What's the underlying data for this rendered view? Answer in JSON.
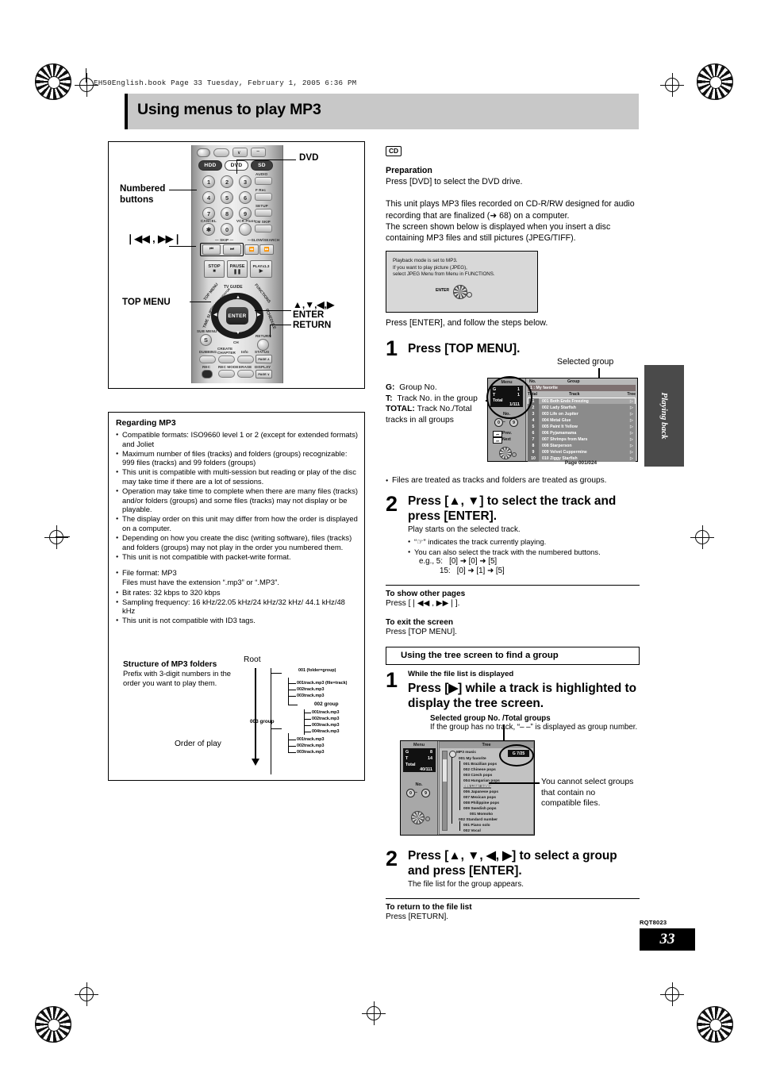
{
  "file_header": "EH50English.book  Page 33  Tuesday, February 1, 2005  6:36 PM",
  "title": "Using menus to play MP3",
  "side_tab": "Playing back",
  "footer": {
    "code": "RQT8023",
    "page": "33"
  },
  "remote": {
    "callouts": {
      "dvd": "DVD",
      "numbered_buttons": "Numbered\nbuttons",
      "skip": "❘◀◀ , ▶▶❘",
      "top_menu": "TOP MENU",
      "cursor": "▲,▼,◀,▶",
      "enter": "ENTER",
      "return": "RETURN"
    },
    "source_buttons": [
      "HDD",
      "DVD",
      "SD"
    ],
    "number_keys": [
      "1",
      "2",
      "3",
      "4",
      "5",
      "6",
      "7",
      "8",
      "9",
      "0"
    ],
    "side_labels": [
      "AUDIO",
      "F Rec",
      "SETUP",
      "CM SKIP"
    ],
    "cancel_label": "CANCEL",
    "vcrplus_label": "VCR Plus+",
    "skip_label": "SKIP",
    "slow_search_label": "SLOW/SEARCH",
    "transport": [
      "STOP",
      "PAUSE",
      "PLAYx1.3"
    ],
    "dial_labels": [
      "TOP MENU",
      "DIRECT NAVIGATOR",
      "TV GUIDE",
      "FUNCTIONS",
      "TIME SLIP",
      "SCHEDULE",
      "CH"
    ],
    "enter_label": "ENTER",
    "return_label": "RETURN",
    "sub_menu_label": "SUB MENU",
    "bottom_buttons": [
      "DUBBING",
      "CREATE CHAPTER",
      "Info",
      "STATUS",
      "REC",
      "REC MODE",
      "ERASE",
      "DISPLAY"
    ],
    "page_up": "PAGE ∧",
    "page_down": "PAGE ∨"
  },
  "regarding_mp3": {
    "heading": "Regarding MP3",
    "bullets": [
      "Compatible formats: ISO9660 level 1 or 2 (except for extended formats) and Joliet",
      "Maximum number of files (tracks) and folders (groups) recognizable: 999 files (tracks) and 99 folders (groups)",
      "This unit is compatible with multi-session but reading or play of the disc may take time if there are a lot of sessions.",
      "Operation may take time to complete when there are many files (tracks) and/or folders (groups) and some files (tracks) may not display or be playable.",
      "The display order on this unit may differ from how the order is displayed on a computer.",
      "Depending on how you create the disc (writing software), files (tracks) and folders (groups) may not play in the order you numbered them.",
      "This unit is not compatible with packet-write format."
    ],
    "bullets2": [
      "File format: MP3",
      "Bit rates: 32 kbps to 320 kbps",
      "Sampling frequency: 16 kHz/22.05 kHz/24 kHz/32 kHz/ 44.1 kHz/48 kHz",
      "This unit is not compatible with ID3 tags."
    ],
    "file_format_sub": "Files must have the extension “.mp3” or “.MP3”.",
    "structure": {
      "heading": "Structure of MP3 folders",
      "text": "Prefix with 3-digit numbers in the order you want to play them.",
      "root_label": "Root",
      "order_label": "Order of play",
      "group1": "001 (folder=group)",
      "group1_files": [
        "001track.mp3 (file=track)",
        "002track.mp3",
        "003track.mp3"
      ],
      "group2": "002 group",
      "group2_files": [
        "001track.mp3",
        "002track.mp3",
        "003track.mp3",
        "004track.mp3"
      ],
      "group3": "003 group",
      "group3_files": [
        "001track.mp3",
        "002track.mp3",
        "003track.mp3"
      ]
    }
  },
  "right": {
    "cd_tag": "CD",
    "preparation_heading": "Preparation",
    "preparation_text": "Press [DVD] to select the DVD drive.",
    "intro": "This unit plays MP3 files recorded on CD-R/RW designed for audio recording that are finalized (➜ 68) on a computer.\nThe screen shown below is displayed when you insert a disc containing MP3 files and still pictures (JPEG/TIFF).",
    "osd_note": "Playback mode is set to MP3.\nIf you want to play picture (JPEG),\nselect JPEG Menu from Menu in FUNCTIONS.",
    "osd_note_enter": "ENTER",
    "after_note": "Press [ENTER], and follow the steps below.",
    "step1": {
      "num": "1",
      "title": "Press [TOP MENU]."
    },
    "selected_group_label": "Selected group",
    "legend": {
      "g": "G:",
      "g_text": "Group No.",
      "t": "T:",
      "t_text": "Track No. in the group",
      "total": "TOTAL:",
      "total_text": "Track No./Total tracks in all groups"
    },
    "files_note": "Files are treated as tracks and folders are treated as groups.",
    "step2": {
      "num": "2",
      "title": "Press [▲, ▼] to select the track and press [ENTER].",
      "line1": "Play starts on the selected track.",
      "bullets": [
        "“☞” indicates the track currently playing.",
        "You can also select the track with the numbered buttons."
      ],
      "eg_label": "e.g., 5:",
      "eg1": "[0] ➜ [0] ➜ [5]",
      "eg2_label": "15:",
      "eg2": "[0] ➜ [1] ➜ [5]"
    },
    "other_pages_h": "To show other pages",
    "other_pages_p": "Press [❘◀◀ , ▶▶❘].",
    "exit_h": "To exit the screen",
    "exit_p": "Press [TOP MENU].",
    "tree_section": "Using the tree screen to find a group",
    "tstep1": {
      "num": "1",
      "cond": "While the file list is displayed",
      "title": "Press [▶] while a track is highlighted to display the tree screen.",
      "callout_h": "Selected group No. /Total groups",
      "callout_p": "If the group has no track, “– –” is displayed as group number."
    },
    "tree_note": "You cannot select groups that contain no compatible files.",
    "tstep2": {
      "num": "2",
      "title": "Press [▲, ▼, ◀, ▶] to select a group and press [ENTER].",
      "line1": "The file list for the group appears."
    },
    "return_h": "To return to the file list",
    "return_p": "Press [RETURN]."
  },
  "file_list_screen": {
    "menu_label": "Menu",
    "g_label": "G",
    "g_value": "1",
    "t_label": "T",
    "t_value": "1",
    "total_label": "Total",
    "total_value": "1/111",
    "no_label": "No.",
    "num_range": [
      "0",
      "–",
      "9"
    ],
    "prev": "Prev.",
    "next": "Next",
    "col_no": "No.",
    "col_group": "Group",
    "col_total": "Total",
    "col_track": "Track",
    "col_tree": "Tree",
    "group_row": "1  :  My favorite",
    "tracks": [
      {
        "no": "1",
        "name": "001 Both Ends Freezing"
      },
      {
        "no": "2",
        "name": "002 Lady Starfish"
      },
      {
        "no": "3",
        "name": "003 Life on Jupiter"
      },
      {
        "no": "4",
        "name": "004 Metal Glue"
      },
      {
        "no": "5",
        "name": "005 Paint It Yellow"
      },
      {
        "no": "6",
        "name": "006 Pyjamamama"
      },
      {
        "no": "7",
        "name": "007 Shrimps from Mars"
      },
      {
        "no": "8",
        "name": "008 Starperson"
      },
      {
        "no": "9",
        "name": "009 Velvet Cuppermine"
      },
      {
        "no": "10",
        "name": "010 Ziggy Starfish"
      }
    ],
    "page": "Page 001/024"
  },
  "tree_screen": {
    "menu_label": "Menu",
    "g_label": "G",
    "g_value": "8",
    "t_label": "T",
    "t_value": "14",
    "total_label": "Total",
    "total_value": "40/111",
    "no_label": "No.",
    "num_range": [
      "0",
      "–",
      "9"
    ],
    "tree_hdr": "Tree",
    "badge": "G  7/25",
    "root": "MP3 music",
    "items": [
      {
        "label": "001 My favorite",
        "indent": 0,
        "hl": false
      },
      {
        "label": "001 Brazilian pops",
        "indent": 1,
        "hl": false
      },
      {
        "label": "002 Chinese pops",
        "indent": 1,
        "hl": false
      },
      {
        "label": "003 Czech pops",
        "indent": 1,
        "hl": false
      },
      {
        "label": "004 Hungarian pops",
        "indent": 1,
        "hl": false
      },
      {
        "label": "005 Liner notes",
        "indent": 1,
        "hl": true
      },
      {
        "label": "006 Japanese pops",
        "indent": 1,
        "hl": false
      },
      {
        "label": "007 Mexican pops",
        "indent": 1,
        "hl": false
      },
      {
        "label": "008 Philippine pops",
        "indent": 1,
        "hl": false
      },
      {
        "label": "009 Swedish pops",
        "indent": 1,
        "hl": false
      },
      {
        "label": "001 Momoko",
        "indent": 2,
        "hl": false
      },
      {
        "label": "002 Standard number",
        "indent": 0,
        "hl": false
      },
      {
        "label": "001 Piano solo",
        "indent": 1,
        "hl": false
      },
      {
        "label": "002 Vocal",
        "indent": 1,
        "hl": false
      }
    ]
  }
}
